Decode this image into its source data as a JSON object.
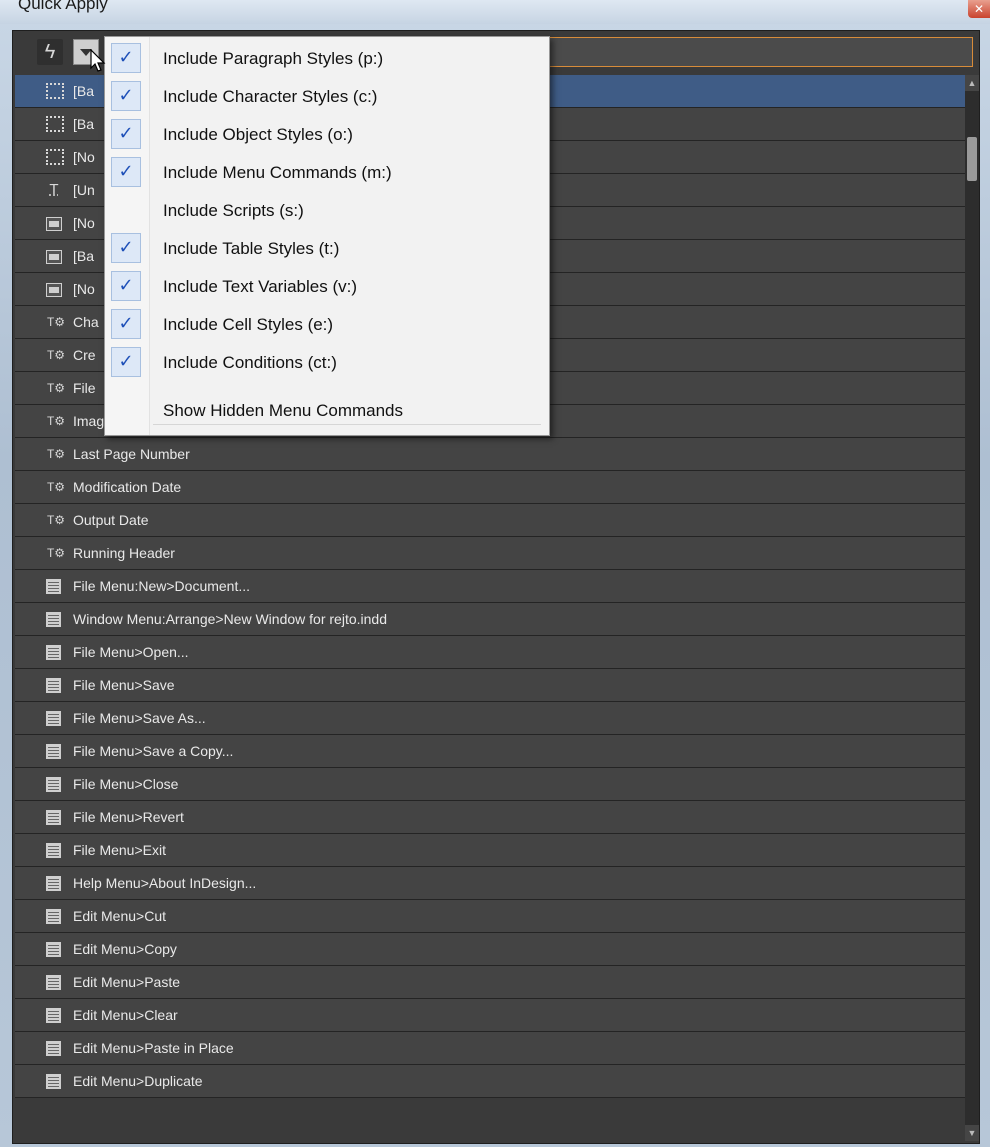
{
  "window": {
    "title": "Quick Apply",
    "close_glyph": "✕"
  },
  "toolbar": {
    "lightning_glyph": "ϟ",
    "search": {
      "value": "",
      "placeholder": ""
    }
  },
  "menu": {
    "items": [
      {
        "label": "Include Paragraph Styles (p:)",
        "checked": true
      },
      {
        "label": "Include Character Styles (c:)",
        "checked": true
      },
      {
        "label": "Include Object Styles (o:)",
        "checked": true
      },
      {
        "label": "Include Menu Commands (m:)",
        "checked": true
      },
      {
        "label": "Include Scripts (s:)",
        "checked": false
      },
      {
        "label": "Include Table Styles (t:)",
        "checked": true
      },
      {
        "label": "Include Text Variables (v:)",
        "checked": true
      },
      {
        "label": "Include Cell Styles (e:)",
        "checked": true
      },
      {
        "label": "Include Conditions (ct:)",
        "checked": true
      }
    ],
    "extra": "Show Hidden Menu Commands",
    "check_glyph": "✓"
  },
  "list": {
    "rows": [
      {
        "icon": "frame",
        "label": "[Ba",
        "selected": true
      },
      {
        "icon": "frame",
        "label": "[Ba",
        "selected": false
      },
      {
        "icon": "frame",
        "label": "[No",
        "selected": false
      },
      {
        "icon": "text",
        "label": "[Un",
        "selected": false
      },
      {
        "icon": "table",
        "label": "[No",
        "selected": false
      },
      {
        "icon": "table",
        "label": "[Ba",
        "selected": false
      },
      {
        "icon": "table",
        "label": "[No",
        "selected": false
      },
      {
        "icon": "variable",
        "label": "Cha",
        "selected": false
      },
      {
        "icon": "variable",
        "label": "Cre",
        "selected": false
      },
      {
        "icon": "variable",
        "label": "File",
        "selected": false
      },
      {
        "icon": "variable",
        "label": "Image Name",
        "selected": false
      },
      {
        "icon": "variable",
        "label": "Last Page Number",
        "selected": false
      },
      {
        "icon": "variable",
        "label": "Modification Date",
        "selected": false
      },
      {
        "icon": "variable",
        "label": "Output Date",
        "selected": false
      },
      {
        "icon": "variable",
        "label": "Running Header",
        "selected": false
      },
      {
        "icon": "command",
        "label": "File Menu:New>Document...",
        "selected": false
      },
      {
        "icon": "command",
        "label": "Window Menu:Arrange>New Window for rejto.indd",
        "selected": false
      },
      {
        "icon": "command",
        "label": "File Menu>Open...",
        "selected": false
      },
      {
        "icon": "command",
        "label": "File Menu>Save",
        "selected": false
      },
      {
        "icon": "command",
        "label": "File Menu>Save As...",
        "selected": false
      },
      {
        "icon": "command",
        "label": "File Menu>Save a Copy...",
        "selected": false
      },
      {
        "icon": "command",
        "label": "File Menu>Close",
        "selected": false
      },
      {
        "icon": "command",
        "label": "File Menu>Revert",
        "selected": false
      },
      {
        "icon": "command",
        "label": "File Menu>Exit",
        "selected": false
      },
      {
        "icon": "command",
        "label": "Help Menu>About InDesign...",
        "selected": false
      },
      {
        "icon": "command",
        "label": "Edit Menu>Cut",
        "selected": false
      },
      {
        "icon": "command",
        "label": "Edit Menu>Copy",
        "selected": false
      },
      {
        "icon": "command",
        "label": "Edit Menu>Paste",
        "selected": false
      },
      {
        "icon": "command",
        "label": "Edit Menu>Clear",
        "selected": false
      },
      {
        "icon": "command",
        "label": "Edit Menu>Paste in Place",
        "selected": false
      },
      {
        "icon": "command",
        "label": "Edit Menu>Duplicate",
        "selected": false
      }
    ]
  },
  "colors": {
    "panel_bg": "#3a3a3a",
    "row_bg": "#444444",
    "selected_row": "#3f5c86",
    "search_border": "#d88c3a",
    "check_color": "#1e50b8"
  }
}
